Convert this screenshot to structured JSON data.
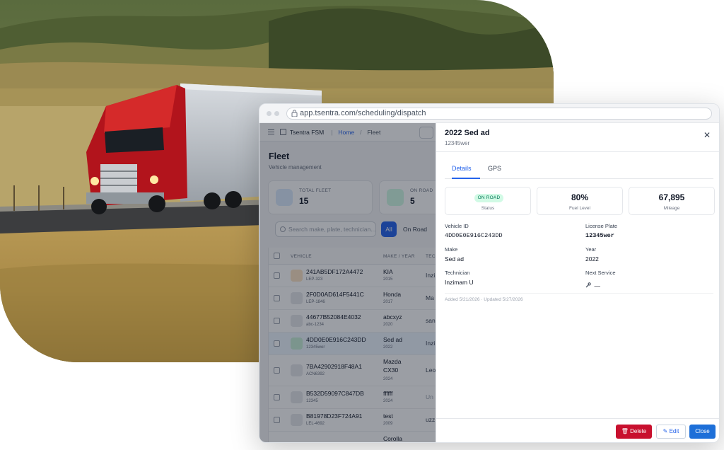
{
  "colors": {
    "accent": "#2563eb",
    "danger": "#c8102e",
    "success_bg": "#d1fae5",
    "success_text": "#047857"
  },
  "browser": {
    "url": "app.tsentra.com/scheduling/dispatch"
  },
  "app": {
    "brand": "Tsentra FSM",
    "breadcrumb": {
      "home": "Home",
      "sep": "/",
      "current": "Fleet"
    },
    "page_title": "Fleet",
    "page_subtitle": "Vehicle management",
    "stats": [
      {
        "label": "TOTAL FLEET",
        "value": "15",
        "icon": "truck-icon"
      },
      {
        "label": "ON ROAD",
        "value": "5",
        "icon": "navigation-icon"
      }
    ],
    "search_placeholder": "Search make, plate, technician...",
    "filters": {
      "all": "All",
      "on_road": "On Road"
    },
    "table": {
      "headers": {
        "vehicle": "VEHICLE",
        "make_year": "MAKE / YEAR",
        "tech": "TEC"
      },
      "rows": [
        {
          "vin": "241AB5DF172A4472",
          "plate": "LEP-323",
          "make": "KIA",
          "year": "2015",
          "tech": "Inzi"
        },
        {
          "vin": "2F0D0AD614F5441C",
          "plate": "LEP-1846",
          "make": "Honda",
          "year": "2017",
          "tech": "Ma"
        },
        {
          "vin": "44677B52084E4032",
          "plate": "abc-1234",
          "make": "abcxyz",
          "year": "2020",
          "tech": "san"
        },
        {
          "vin": "4DD0E0E916C243DD",
          "plate": "12345wer",
          "make": "Sed ad",
          "year": "2022",
          "tech": "Inzi"
        },
        {
          "vin": "7BA42902918F48A1",
          "plate": "ACN6392",
          "make": "Mazda CX30",
          "year": "2024",
          "tech": "Leo"
        },
        {
          "vin": "B532D59097C847DB",
          "plate": "12345",
          "make": "ffffff",
          "year": "2024",
          "tech": "Un"
        },
        {
          "vin": "B81978D23F724A91",
          "plate": "LEL-4692",
          "make": "test",
          "year": "2009",
          "tech": "uzz"
        },
        {
          "vin": "",
          "plate": "",
          "make": "Corolla",
          "year": "",
          "tech": ""
        }
      ]
    }
  },
  "panel": {
    "title": "2022 Sed ad",
    "subtitle": "12345wer",
    "tabs": {
      "details": "Details",
      "gps": "GPS"
    },
    "cards": {
      "status": {
        "badge": "ON ROAD",
        "label": "Status"
      },
      "fuel": {
        "value": "80%",
        "label": "Fuel Level"
      },
      "mileage": {
        "value": "67,895",
        "label": "Mileage"
      }
    },
    "fields": {
      "vehicle_id": {
        "label": "Vehicle ID",
        "value": "4DD0E0E916C243DD"
      },
      "license_plate": {
        "label": "License Plate",
        "value": "12345wer"
      },
      "make": {
        "label": "Make",
        "value": "Sed ad"
      },
      "year": {
        "label": "Year",
        "value": "2022"
      },
      "technician": {
        "label": "Technician",
        "value": "Inzimam U"
      },
      "next_service": {
        "label": "Next Service",
        "value": "—"
      }
    },
    "meta": "Added 5/21/2026 · Updated 5/27/2026",
    "buttons": {
      "delete": "Delete",
      "edit": "Edit",
      "close": "Close"
    },
    "close_glyph": "✕"
  }
}
